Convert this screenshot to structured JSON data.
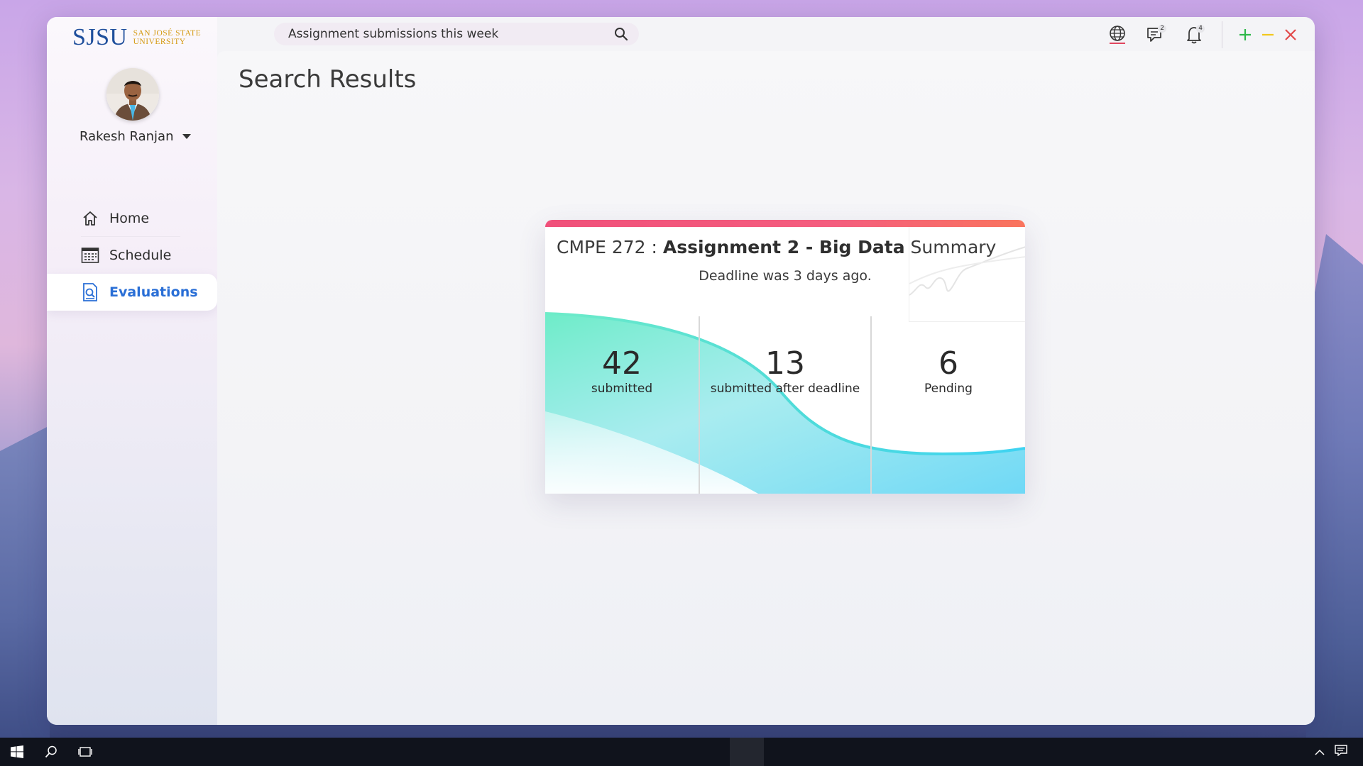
{
  "logo": {
    "main": "SJSU",
    "sub_line1": "SAN JOSÉ STATE",
    "sub_line2": "UNIVERSITY"
  },
  "search": {
    "value": "Assignment submissions this week",
    "icon": "search-icon"
  },
  "top_icons": [
    {
      "name": "globe-icon"
    },
    {
      "name": "messages-icon",
      "badge": "2"
    },
    {
      "name": "notifications-bell-icon",
      "badge": "4"
    }
  ],
  "window_controls": {
    "add": "plus-icon",
    "minimize": "minimize-icon",
    "close": "close-icon"
  },
  "user": {
    "name": "Rakesh Ranjan"
  },
  "nav": {
    "items": [
      {
        "label": "Home",
        "icon": "home-icon"
      },
      {
        "label": "Schedule",
        "icon": "calendar-icon"
      },
      {
        "label": "Evaluations",
        "icon": "document-search-icon",
        "active": true
      }
    ]
  },
  "page": {
    "title": "Search Results"
  },
  "card": {
    "course": "CMPE 272 : ",
    "assignment": "Assignment 2 - Big Data",
    "suffix": " Summary",
    "deadline": "Deadline was 3 days ago.",
    "stats": [
      {
        "value": "42",
        "label": "submitted"
      },
      {
        "value": "13",
        "label": "submitted after deadline"
      },
      {
        "value": "6",
        "label": "Pending"
      }
    ]
  },
  "colors": {
    "accent_blue": "#2a6fd6",
    "card_top": "#f0507a",
    "wave_green": "#6eecc8",
    "wave_cyan": "#3fd3f2",
    "add_green": "#2fb84a",
    "minimize_yellow": "#f2c81e",
    "close_red": "#e24a4a"
  }
}
